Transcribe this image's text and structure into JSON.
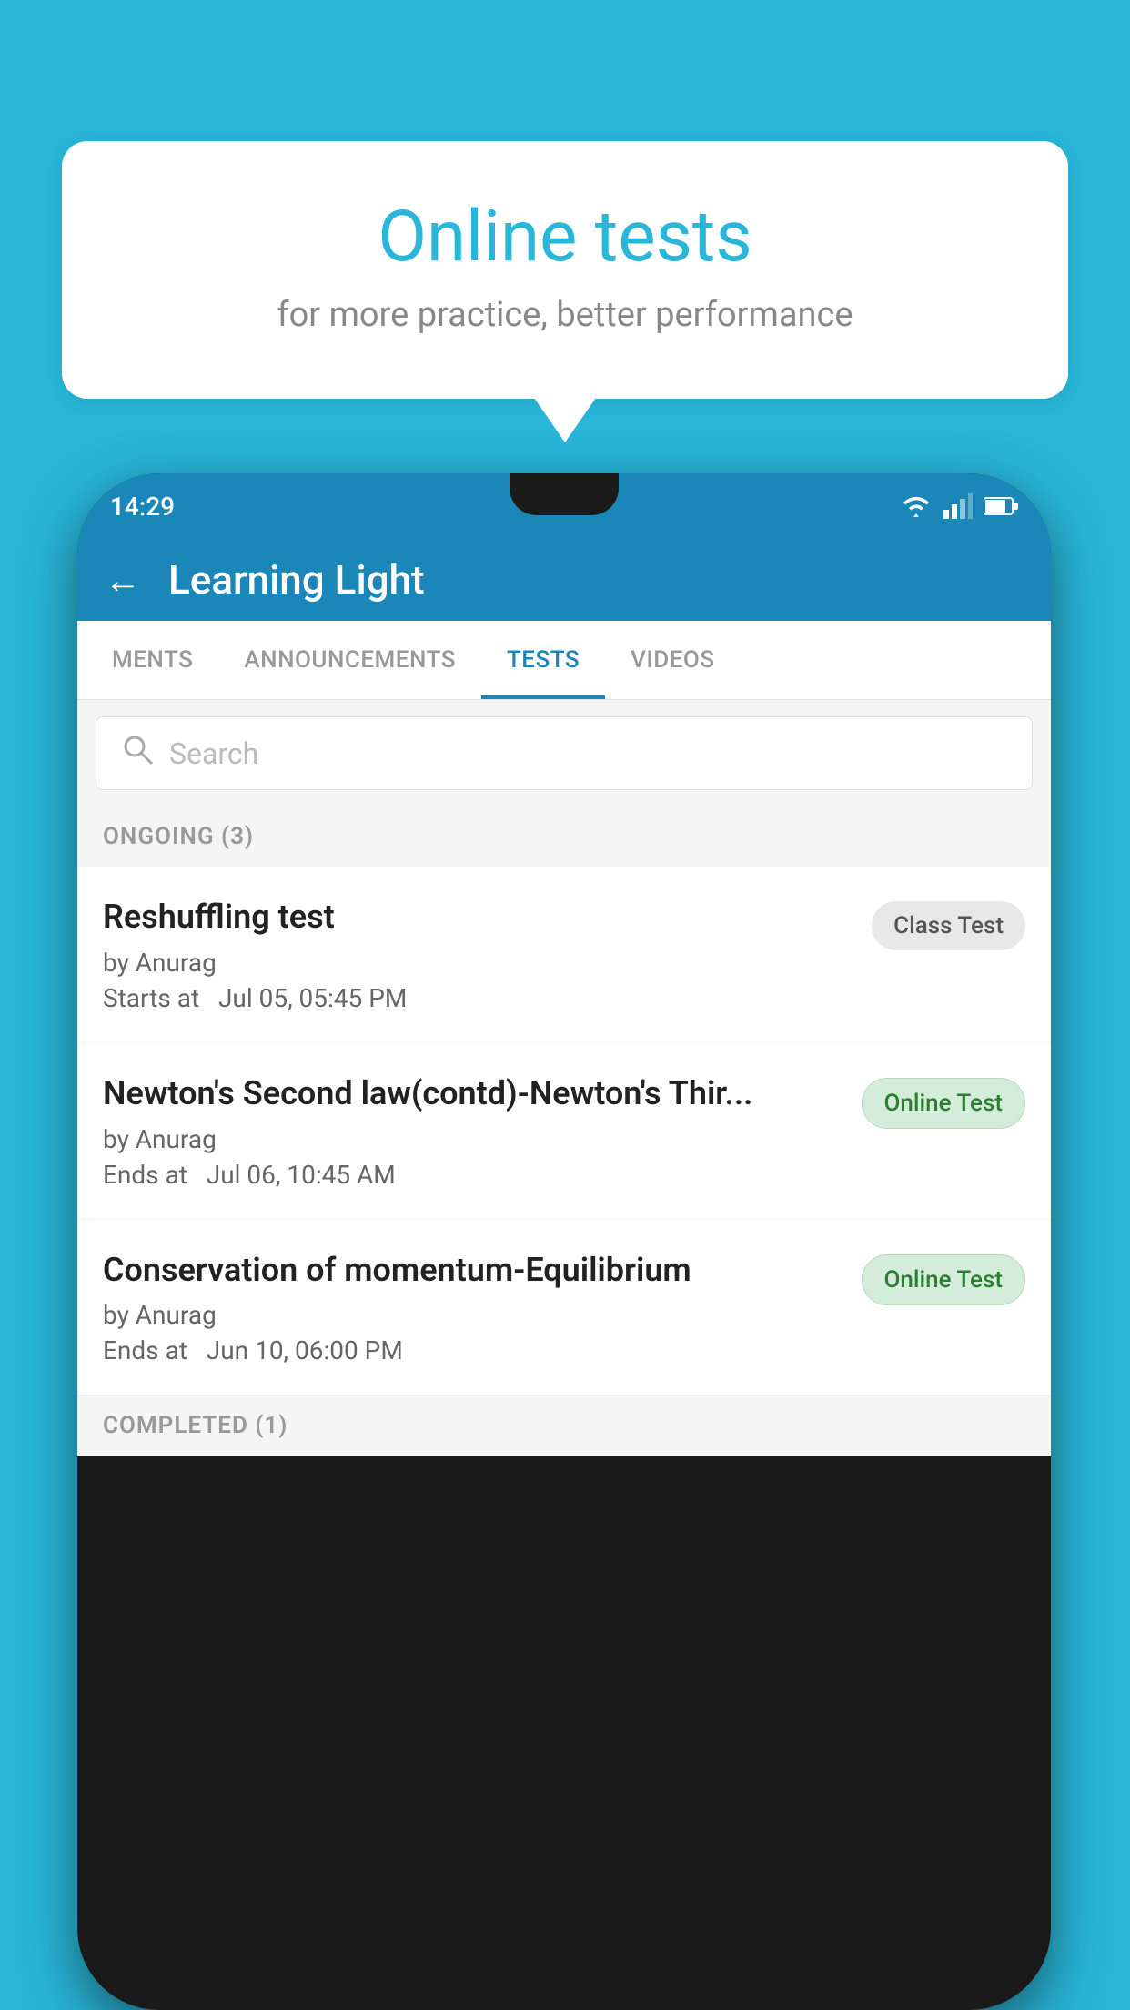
{
  "background_color": "#29B6D8",
  "speech_bubble": {
    "title": "Online tests",
    "subtitle": "for more practice, better performance"
  },
  "phone": {
    "status_bar": {
      "time": "14:29"
    },
    "header": {
      "title": "Learning Light",
      "back_label": "←"
    },
    "tabs": [
      {
        "label": "MENTS",
        "active": false
      },
      {
        "label": "ANNOUNCEMENTS",
        "active": false
      },
      {
        "label": "TESTS",
        "active": true
      },
      {
        "label": "VIDEOS",
        "active": false
      }
    ],
    "search": {
      "placeholder": "Search"
    },
    "ongoing_section": {
      "label": "ONGOING (3)"
    },
    "tests": [
      {
        "name": "Reshuffling test",
        "author": "by Anurag",
        "date": "Starts at  Jul 05, 05:45 PM",
        "badge": "Class Test",
        "badge_type": "class"
      },
      {
        "name": "Newton's Second law(contd)-Newton's Thir...",
        "author": "by Anurag",
        "date": "Ends at  Jul 06, 10:45 AM",
        "badge": "Online Test",
        "badge_type": "online"
      },
      {
        "name": "Conservation of momentum-Equilibrium",
        "author": "by Anurag",
        "date": "Ends at  Jun 10, 06:00 PM",
        "badge": "Online Test",
        "badge_type": "online"
      }
    ],
    "completed_section": {
      "label": "COMPLETED (1)"
    }
  }
}
